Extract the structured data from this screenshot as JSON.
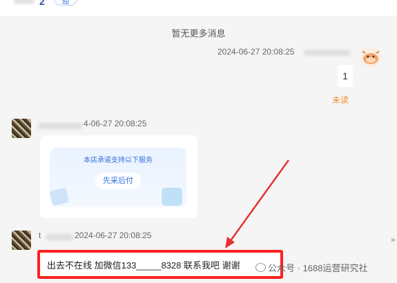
{
  "topbar": {
    "count": "2",
    "pill_label": "迎"
  },
  "chat": {
    "no_more": "暂无更多消息",
    "self_message": {
      "timestamp": "2024-06-27 20:08:25",
      "text": "1",
      "status": "未读"
    },
    "card_message": {
      "timestamp_partial": "4-06-27 20:08:25",
      "card_title": "本店承诺支持以下服务",
      "card_button": "先采后付"
    },
    "text_message": {
      "name_prefix": "t",
      "timestamp_partial": "2024-06-27 20:08:25",
      "text": "出去不在线 加微信133_____8328 联系我吧 谢谢"
    }
  },
  "side": {
    "collapse_glyph": "»"
  },
  "watermark": {
    "text": "公众号 · 1688运营研究社"
  },
  "colors": {
    "highlight": "#ff1f1f",
    "unread": "#f08a2c",
    "link_blue": "#2f6fe0"
  }
}
